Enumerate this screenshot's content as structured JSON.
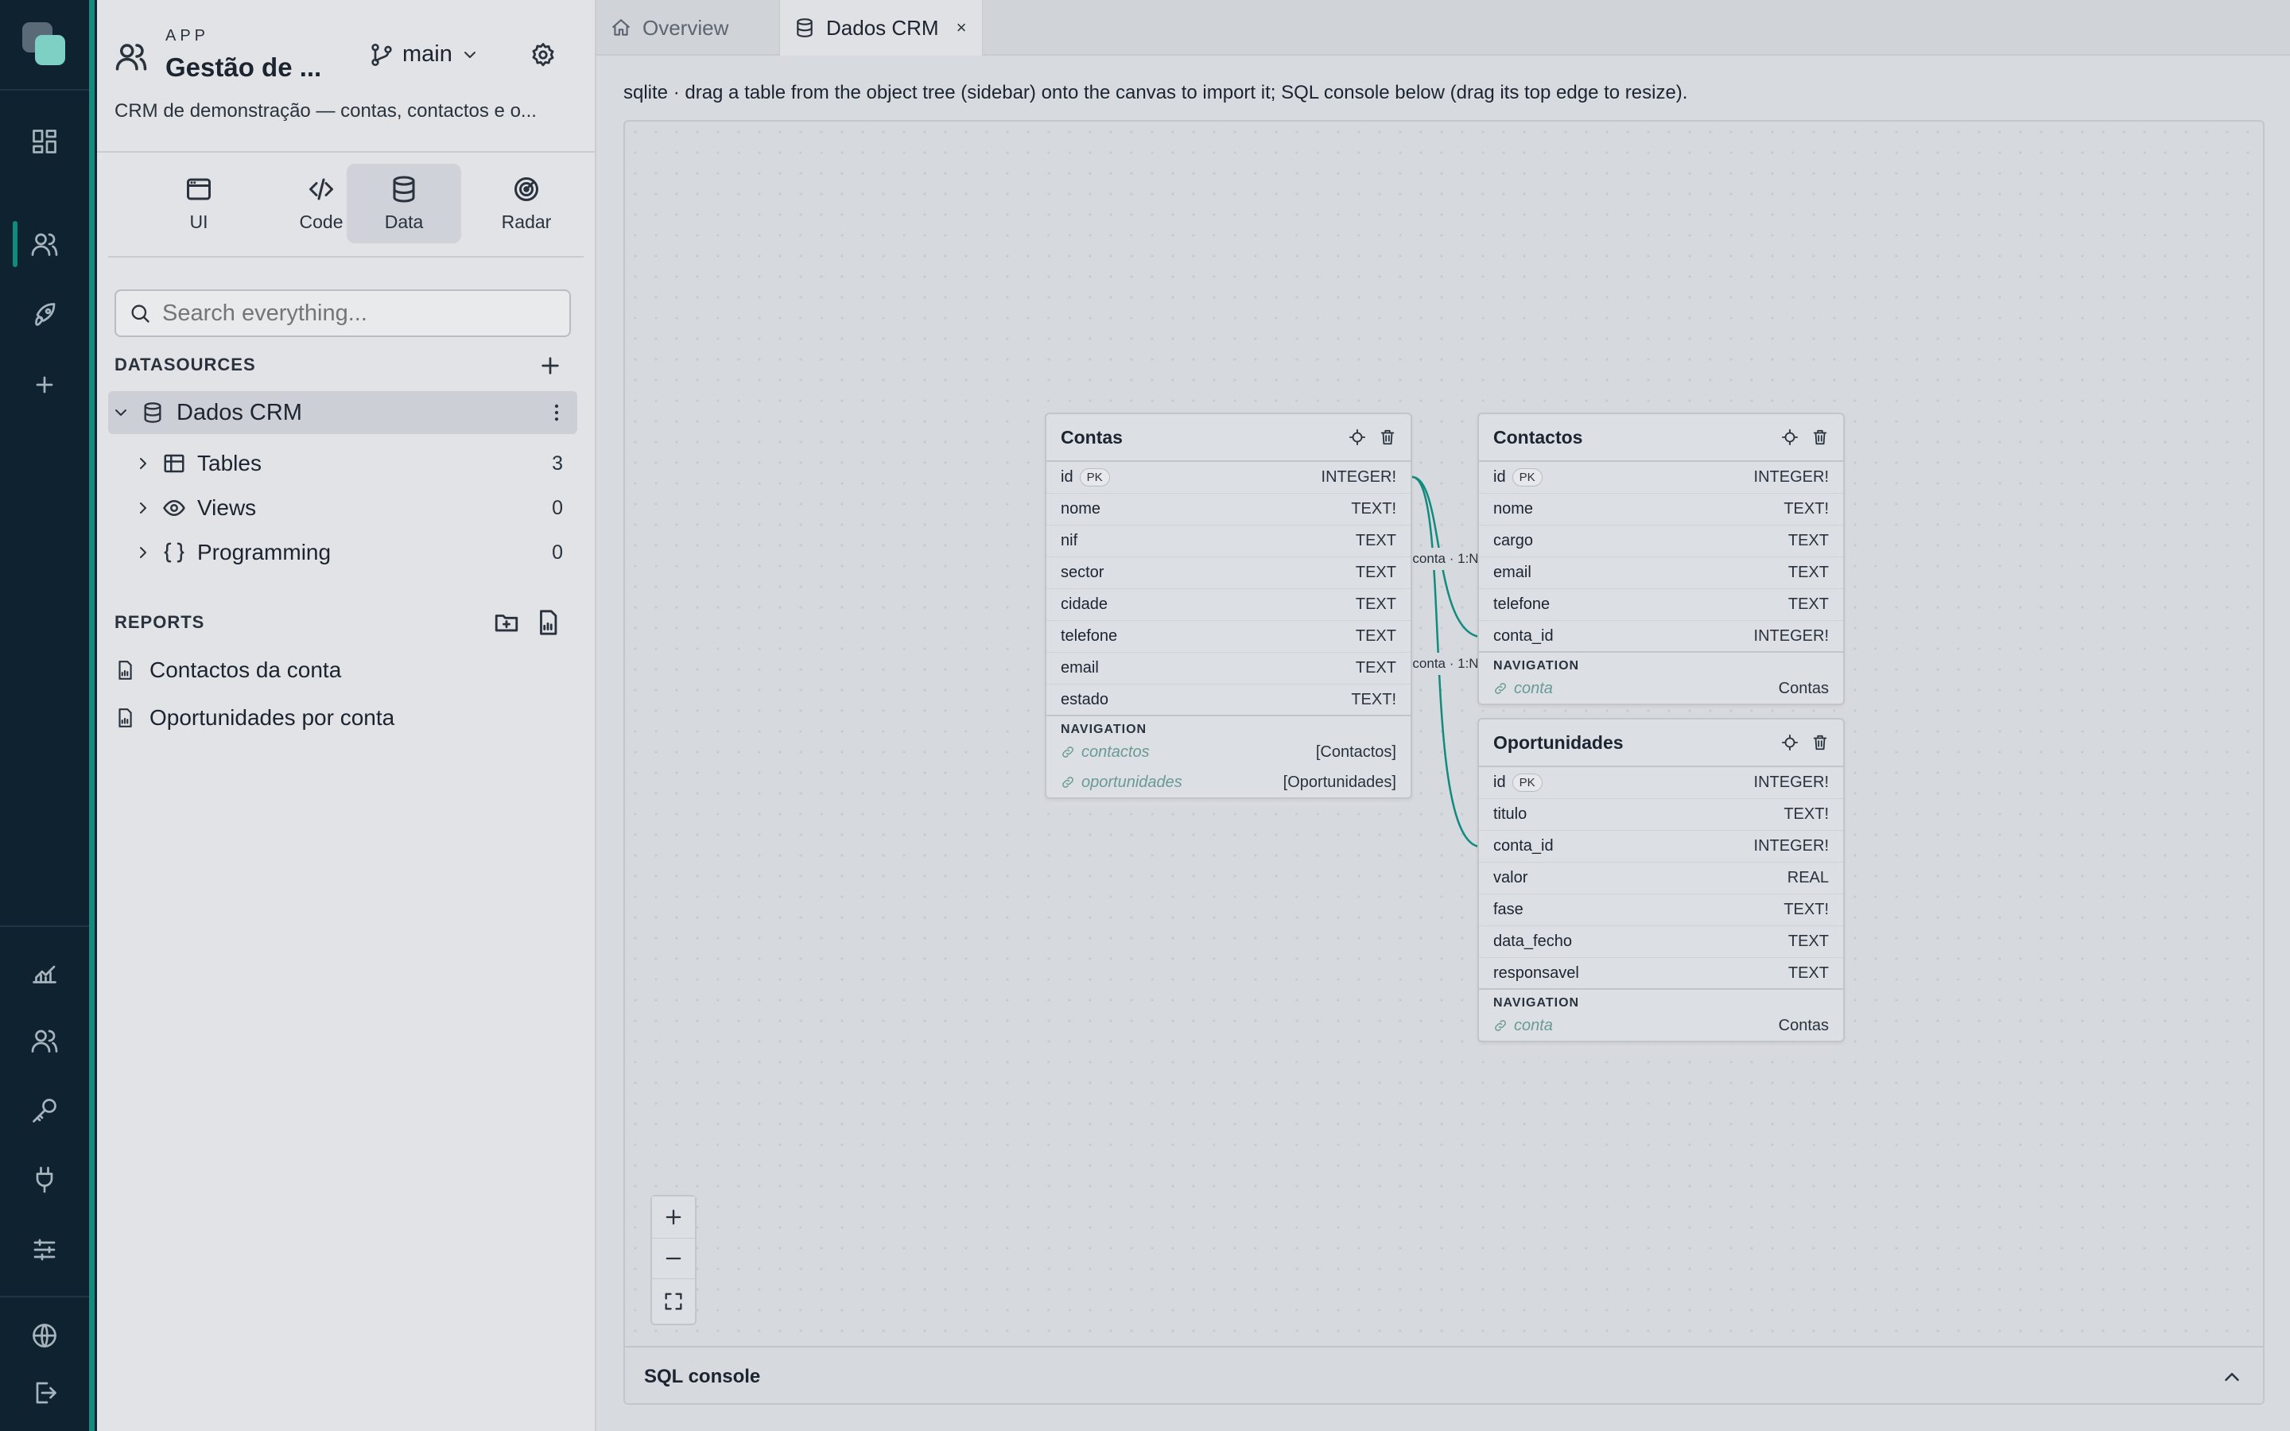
{
  "app": {
    "kicker": "APP",
    "name": "Gestão de ...",
    "branch": "main",
    "description": "CRM de demonstração — contas, contactos e o..."
  },
  "modes": [
    {
      "label": "UI",
      "icon": "window-icon"
    },
    {
      "label": "Code",
      "icon": "code-icon"
    },
    {
      "label": "Data",
      "icon": "database-icon",
      "active": true
    },
    {
      "label": "Radar",
      "icon": "radar-icon"
    }
  ],
  "search": {
    "placeholder": "Search everything..."
  },
  "datasources": {
    "heading": "DATASOURCES",
    "name": "Dados CRM",
    "items": [
      {
        "label": "Tables",
        "count": "3"
      },
      {
        "label": "Views",
        "count": "0"
      },
      {
        "label": "Programming",
        "count": "0"
      }
    ]
  },
  "reports": {
    "heading": "REPORTS",
    "items": [
      "Contactos da conta",
      "Oportunidades por conta"
    ]
  },
  "tabs": [
    {
      "label": "Overview"
    },
    {
      "label": "Dados CRM",
      "close": "×"
    }
  ],
  "hint": "sqlite · drag a table from the object tree (sidebar) onto the canvas to import it; SQL console below (drag its top edge to resize).",
  "entities": {
    "contas": {
      "name": "Contas",
      "fields": [
        {
          "n": "id",
          "pk": "PK",
          "t": "INTEGER!"
        },
        {
          "n": "nome",
          "t": "TEXT!"
        },
        {
          "n": "nif",
          "t": "TEXT"
        },
        {
          "n": "sector",
          "t": "TEXT"
        },
        {
          "n": "cidade",
          "t": "TEXT"
        },
        {
          "n": "telefone",
          "t": "TEXT"
        },
        {
          "n": "email",
          "t": "TEXT"
        },
        {
          "n": "estado",
          "t": "TEXT!"
        }
      ],
      "nav_heading": "NAVIGATION",
      "nav": [
        {
          "n": "contactos",
          "t": "[Contactos]"
        },
        {
          "n": "oportunidades",
          "t": "[Oportunidades]"
        }
      ]
    },
    "contactos": {
      "name": "Contactos",
      "fields": [
        {
          "n": "id",
          "pk": "PK",
          "t": "INTEGER!"
        },
        {
          "n": "nome",
          "t": "TEXT!"
        },
        {
          "n": "cargo",
          "t": "TEXT"
        },
        {
          "n": "email",
          "t": "TEXT"
        },
        {
          "n": "telefone",
          "t": "TEXT"
        },
        {
          "n": "conta_id",
          "t": "INTEGER!"
        }
      ],
      "nav_heading": "NAVIGATION",
      "nav": [
        {
          "n": "conta",
          "t": "Contas"
        }
      ]
    },
    "oportunidades": {
      "name": "Oportunidades",
      "fields": [
        {
          "n": "id",
          "pk": "PK",
          "t": "INTEGER!"
        },
        {
          "n": "titulo",
          "t": "TEXT!"
        },
        {
          "n": "conta_id",
          "t": "INTEGER!"
        },
        {
          "n": "valor",
          "t": "REAL"
        },
        {
          "n": "fase",
          "t": "TEXT!"
        },
        {
          "n": "data_fecho",
          "t": "TEXT"
        },
        {
          "n": "responsavel",
          "t": "TEXT"
        }
      ],
      "nav_heading": "NAVIGATION",
      "nav": [
        {
          "n": "conta",
          "t": "Contas"
        }
      ]
    }
  },
  "relations": [
    {
      "label": "conta · 1:N"
    },
    {
      "label": "conta · 1:N"
    }
  ],
  "sql_console": {
    "label": "SQL console"
  },
  "colors": {
    "accent": "#138a7e",
    "rail": "#0e2230"
  }
}
